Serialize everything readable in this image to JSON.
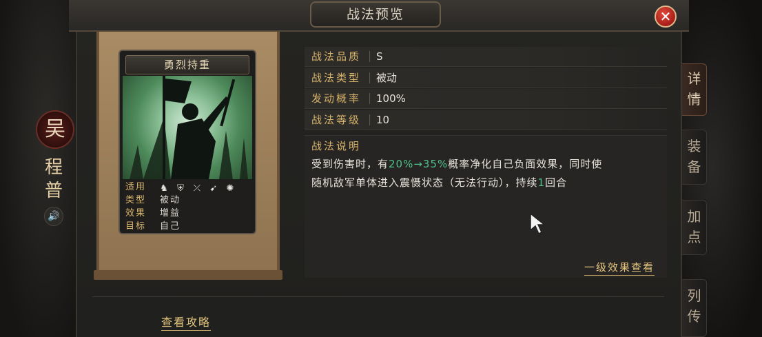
{
  "window": {
    "title": "战法预览",
    "close_icon": "close-icon"
  },
  "hero": {
    "faction": "吴",
    "name": "程普",
    "sound_icon": "speaker-icon"
  },
  "card": {
    "name": "勇烈持重",
    "rows": [
      {
        "key": "适用",
        "icons": [
          "cavalry-icon",
          "shield-icon",
          "bow-icon",
          "spear-icon",
          "siege-icon"
        ]
      },
      {
        "key": "类型",
        "value": "被动"
      },
      {
        "key": "效果",
        "value": "增益"
      },
      {
        "key": "目标",
        "value": "自己"
      }
    ]
  },
  "stats": [
    {
      "key": "战法品质",
      "value": "S"
    },
    {
      "key": "战法类型",
      "value": "被动"
    },
    {
      "key": "发动概率",
      "value": "100%"
    },
    {
      "key": "战法等级",
      "value": "10"
    }
  ],
  "description": {
    "title": "战法说明",
    "text_a": "受到伤害时，有",
    "text_green": "20%→35%",
    "text_b": "概率净化自己负面效果，同时使",
    "text_c": "随机敌军单体进入震慑状态（无法行动），持续",
    "text_green2": "1",
    "text_d": "回合"
  },
  "links": {
    "level_effects": "一级效果查看",
    "guide": "查看攻略"
  },
  "side_tabs": [
    {
      "label": "详情",
      "active": true
    },
    {
      "label": "装备",
      "active": false
    },
    {
      "label": "加点",
      "active": false
    },
    {
      "label": "列传",
      "active": false
    }
  ],
  "colors": {
    "gold": "#d7b46b",
    "highlight_green": "#4fc18a",
    "close_red": "#c0271d"
  }
}
